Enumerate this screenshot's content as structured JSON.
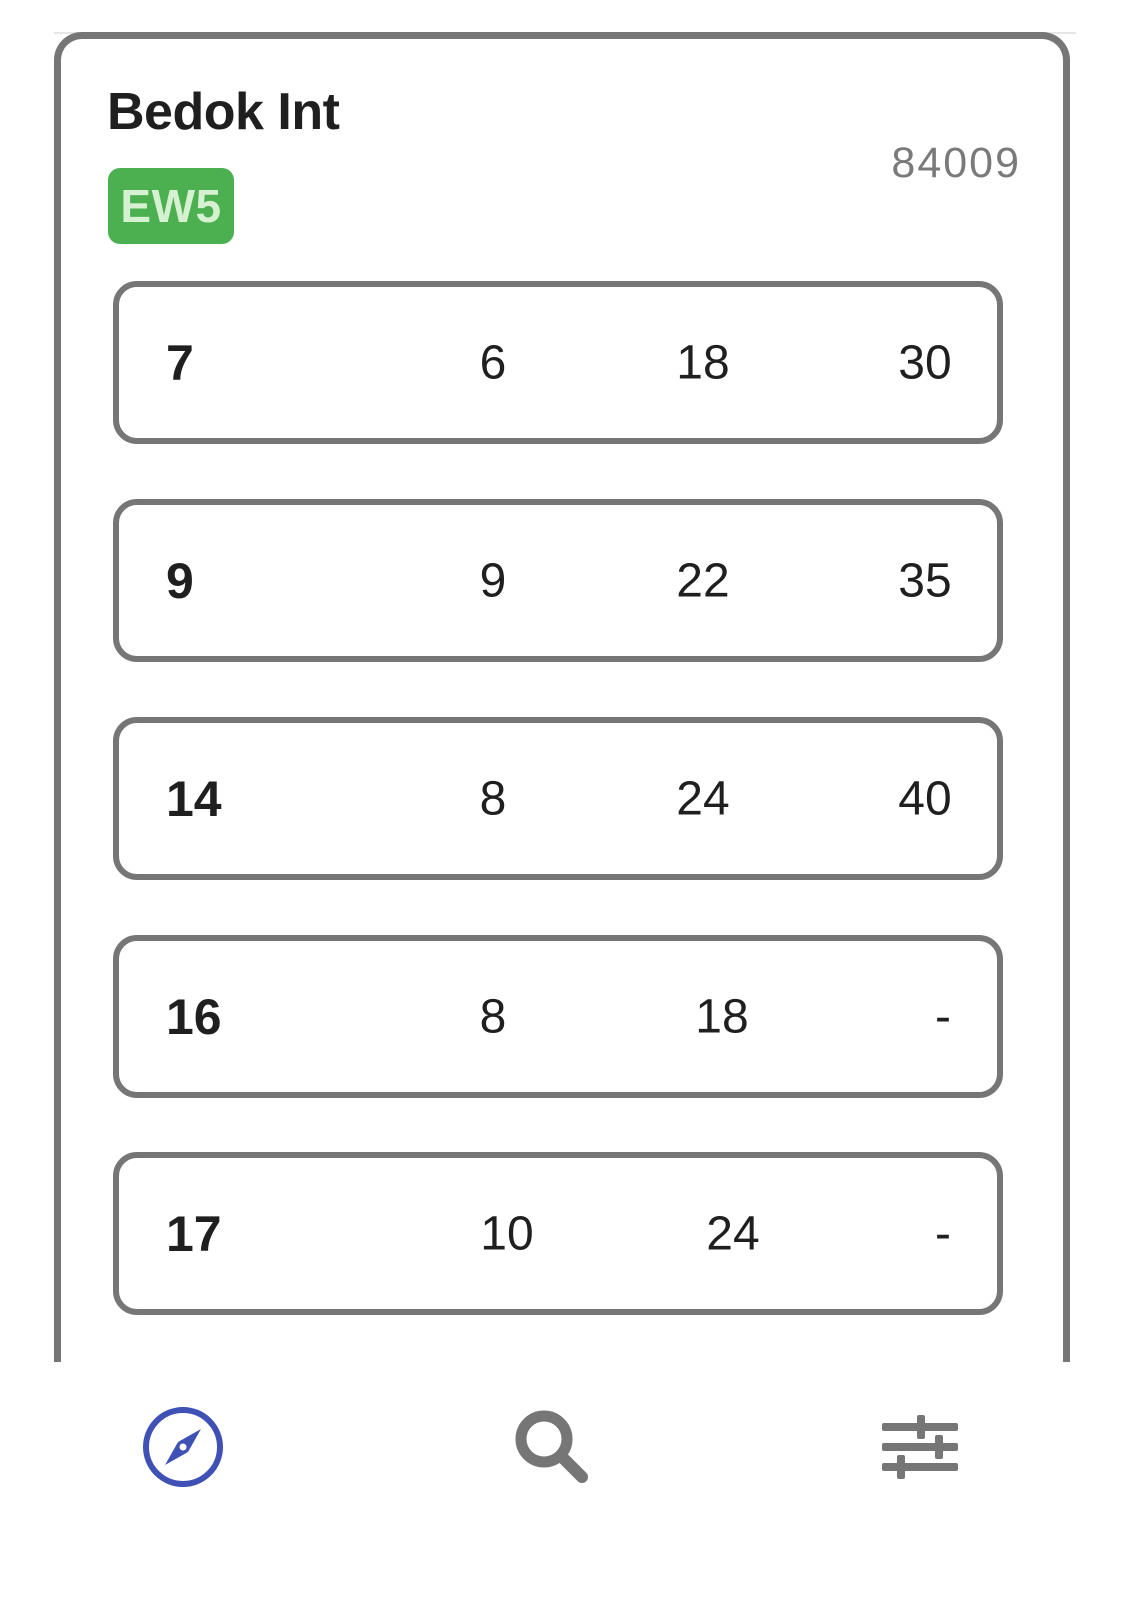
{
  "stop": {
    "name": "Bedok Int",
    "code": "84009",
    "mrt_badge": {
      "label": "EW5",
      "background": "#4CAF50",
      "text_color": "#D6F0D2"
    }
  },
  "services": [
    {
      "number": "7",
      "etas": [
        "6",
        "18",
        "30"
      ]
    },
    {
      "number": "9",
      "etas": [
        "9",
        "22",
        "35"
      ]
    },
    {
      "number": "14",
      "etas": [
        "8",
        "24",
        "40"
      ]
    },
    {
      "number": "16",
      "etas": [
        "8",
        "18",
        "-"
      ]
    },
    {
      "number": "17",
      "etas": [
        "10",
        "24",
        "-"
      ]
    }
  ],
  "nav": {
    "items": [
      {
        "icon": "compass-icon",
        "active": true
      },
      {
        "icon": "search-icon",
        "active": false
      },
      {
        "icon": "sliders-icon",
        "active": false
      }
    ],
    "active_color": "#3F51B5",
    "inactive_color": "#767676"
  }
}
